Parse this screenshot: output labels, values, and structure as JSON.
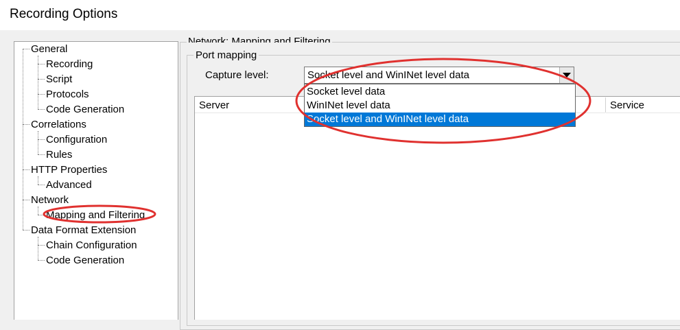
{
  "window": {
    "title": "Recording Options"
  },
  "tree": {
    "items": [
      {
        "label": "General",
        "level": 0
      },
      {
        "label": "Recording",
        "level": 1
      },
      {
        "label": "Script",
        "level": 1
      },
      {
        "label": "Protocols",
        "level": 1
      },
      {
        "label": "Code Generation",
        "level": 1
      },
      {
        "label": "Correlations",
        "level": 0
      },
      {
        "label": "Configuration",
        "level": 1
      },
      {
        "label": "Rules",
        "level": 1
      },
      {
        "label": "HTTP Properties",
        "level": 0
      },
      {
        "label": "Advanced",
        "level": 1
      },
      {
        "label": "Network",
        "level": 0
      },
      {
        "label": "Mapping and Filtering",
        "level": 1,
        "selected": true
      },
      {
        "label": "Data Format Extension",
        "level": 0
      },
      {
        "label": "Chain Configuration",
        "level": 1
      },
      {
        "label": "Code Generation",
        "level": 1
      }
    ]
  },
  "panel": {
    "section_title": "Network: Mapping and Filtering",
    "group_title": "Port mapping",
    "capture_level": {
      "label": "Capture level:",
      "value": "Socket level and WinINet level data",
      "options": [
        "Socket level data",
        "WinINet level data",
        "Socket level and WinINet level data"
      ],
      "selected_index": 2
    },
    "table": {
      "columns": [
        "Server",
        "Service"
      ]
    }
  },
  "colors": {
    "selection": "#0078d7",
    "annotation_ring": "#e0312f"
  }
}
